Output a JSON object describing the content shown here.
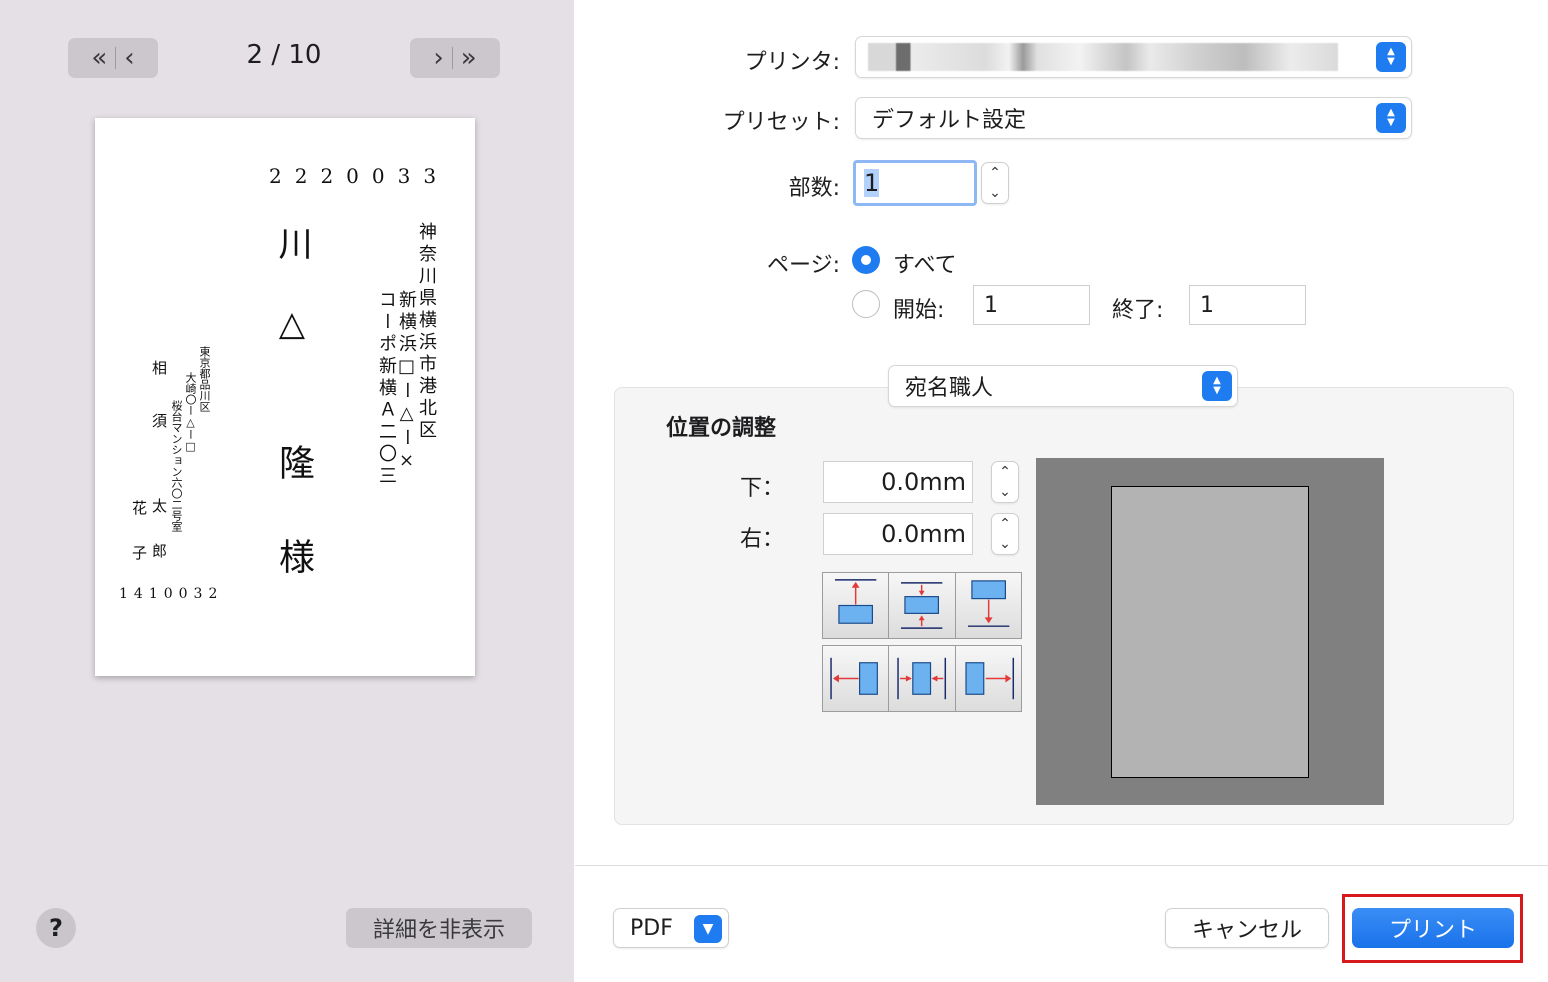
{
  "preview": {
    "page_counter": "2 / 10",
    "nav_first_glyph": "«",
    "nav_prev_glyph": "‹",
    "nav_next_glyph": "›",
    "nav_last_glyph": "»",
    "envelope": {
      "recipient_zip": "2220033",
      "recipient_address_line1": "神奈川県横浜市港北区",
      "recipient_address_line2": "新横浜□ー△ー×",
      "recipient_address_line3": "コーポ新横Ａ二〇三",
      "recipient_name_1": "川",
      "recipient_name_2": "△",
      "recipient_name_3": "隆",
      "honorific": "様",
      "sender_address_line1": "東京都品川区",
      "sender_address_line2": "大崎〇ー△ー□",
      "sender_address_line3": "桜台マンション六〇二号室",
      "sender_name_1": "相須",
      "sender_name_2": "花子",
      "sender_name_3": "太郎",
      "sender_zip": "1410032"
    },
    "help_label": "?",
    "hide_details_label": "詳細を非表示"
  },
  "settings": {
    "printer_label": "プリンタ:",
    "preset_label": "プリセット:",
    "preset_value": "デフォルト設定",
    "copies_label": "部数:",
    "copies_value": "1",
    "pages_label": "ページ:",
    "pages_all_label": "すべて",
    "pages_from_label": "開始:",
    "pages_from_value": "1",
    "pages_to_label": "終了:",
    "pages_to_value": "1",
    "pages_selected": "all"
  },
  "app_panel": {
    "popup_value": "宛名職人",
    "section_title": "位置の調整",
    "bottom_label": "下：",
    "bottom_value": "0.0mm",
    "right_label": "右：",
    "right_value": "0.0mm"
  },
  "footer": {
    "pdf_label": "PDF",
    "cancel_label": "キャンセル",
    "print_label": "プリント"
  },
  "colors": {
    "accent": "#1f7cf0",
    "highlight_box": "#d8191c"
  }
}
